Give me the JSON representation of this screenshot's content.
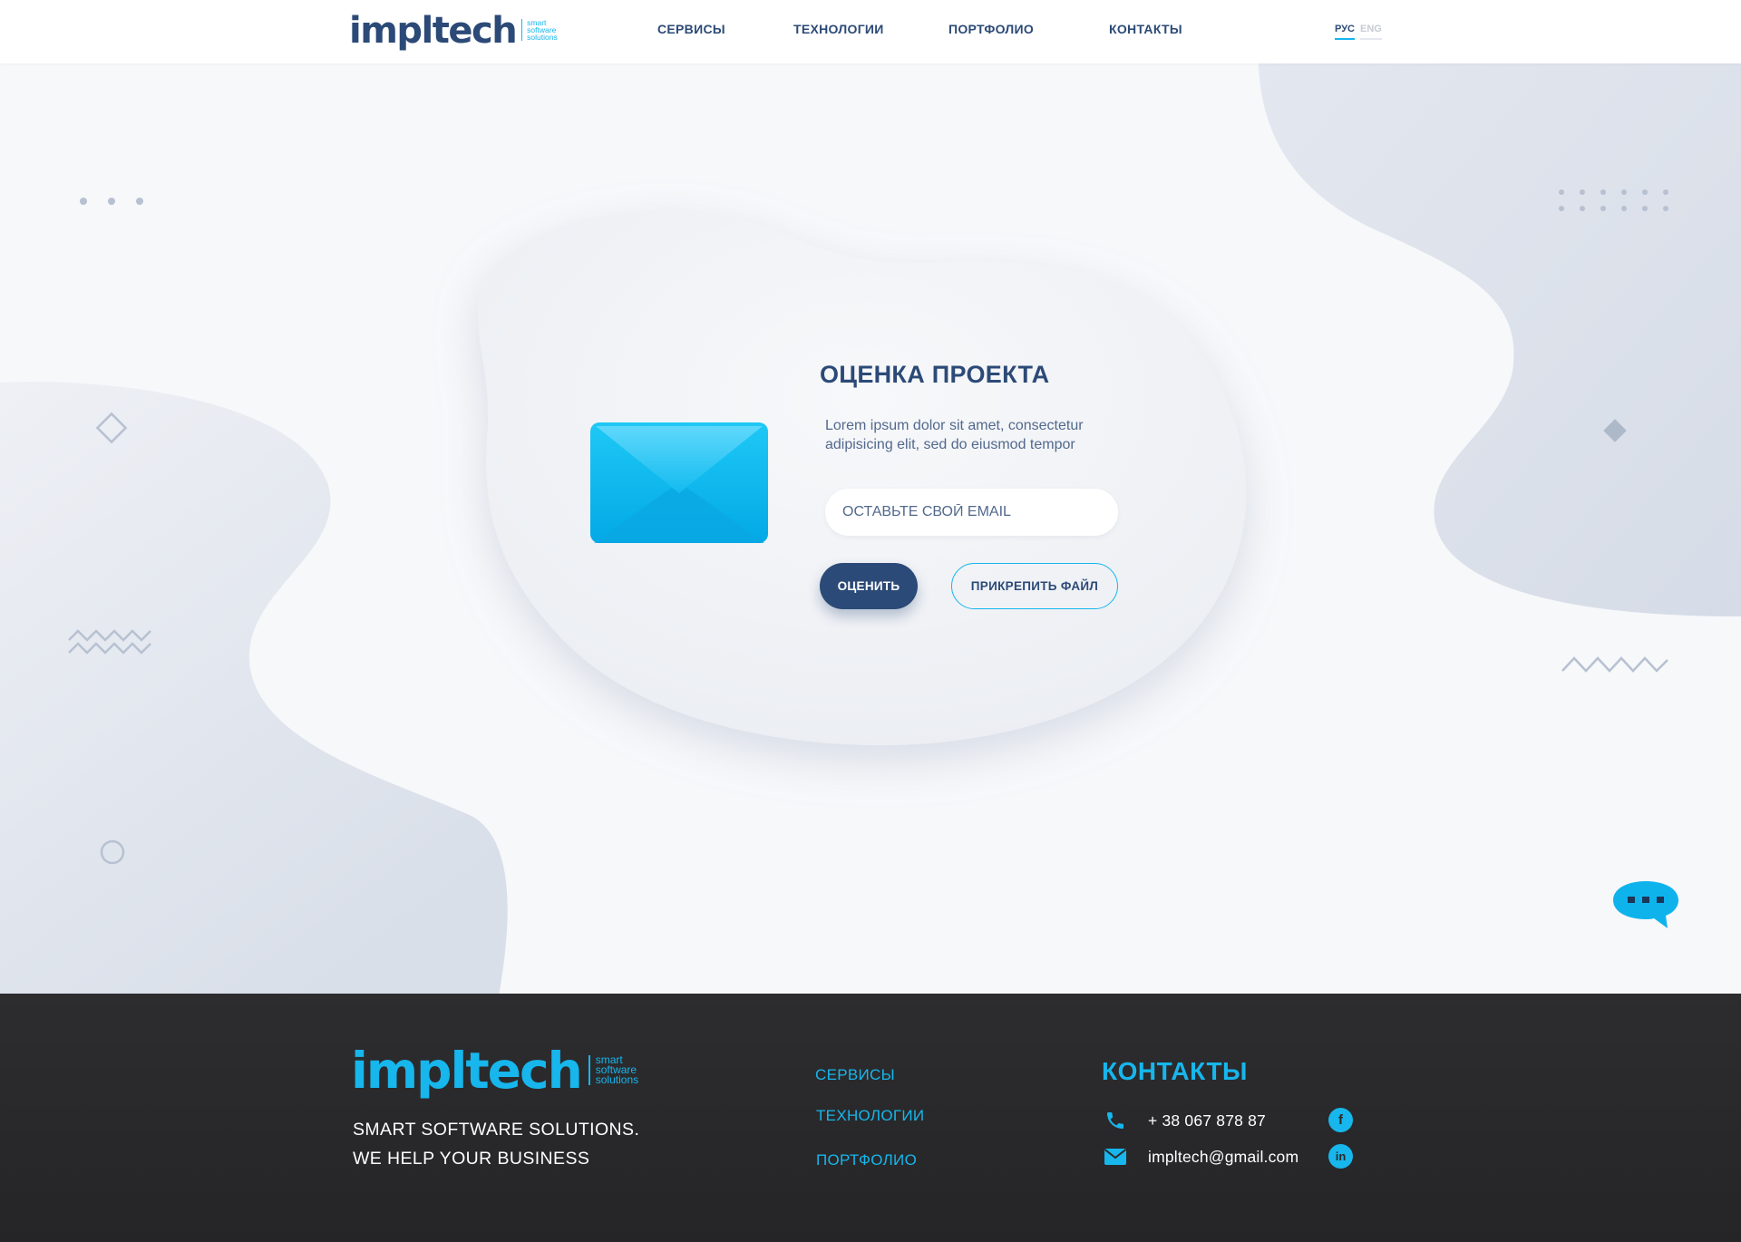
{
  "colors": {
    "primary": "#2c4a77",
    "accent": "#17b6ec",
    "footer_bg": "#29292b",
    "background": "#f7f8fa"
  },
  "header": {
    "logo": {
      "word": "impltech",
      "tagline": [
        "smart",
        "software",
        "solutions"
      ]
    },
    "nav": [
      {
        "label": "СЕРВИСЫ"
      },
      {
        "label": "ТЕХНОЛОГИИ"
      },
      {
        "label": "ПОРТФОЛИО"
      },
      {
        "label": "КОНТАКТЫ"
      }
    ],
    "lang": {
      "active": "РУС",
      "inactive": "ENG"
    }
  },
  "main": {
    "icon": "envelope-icon",
    "title": "ОЦЕНКА ПРОЕКТА",
    "description": "Lorem ipsum dolor sit amet, consectetur adipisicing elit, sed do eiusmod tempor",
    "email_placeholder": "ОСТАВЬТЕ СВОЙ EMAIL",
    "rate_button": "ОЦЕНИТЬ",
    "attach_button": "ПРИКРЕПИТЬ ФАЙЛ",
    "chat_icon": "chat-bubble-icon"
  },
  "footer": {
    "logo": {
      "word": "impltech",
      "tagline": [
        "smart",
        "software",
        "solutions"
      ]
    },
    "slogan": [
      "SMART SOFTWARE SOLUTIONS.",
      "WE HELP YOUR BUSINESS"
    ],
    "nav": [
      {
        "label": "СЕРВИСЫ"
      },
      {
        "label": "ТЕХНОЛОГИИ"
      },
      {
        "label": "ПОРТФОЛИО"
      }
    ],
    "contacts": {
      "title": "КОНТАКТЫ",
      "phone": "+ 38 067 878 87",
      "email": "impltech@gmail.com",
      "phone_icon": "phone-icon",
      "email_icon": "mail-icon",
      "social": [
        {
          "icon": "facebook-icon",
          "glyph": "f"
        },
        {
          "icon": "linkedin-icon",
          "glyph": "in"
        }
      ]
    }
  }
}
